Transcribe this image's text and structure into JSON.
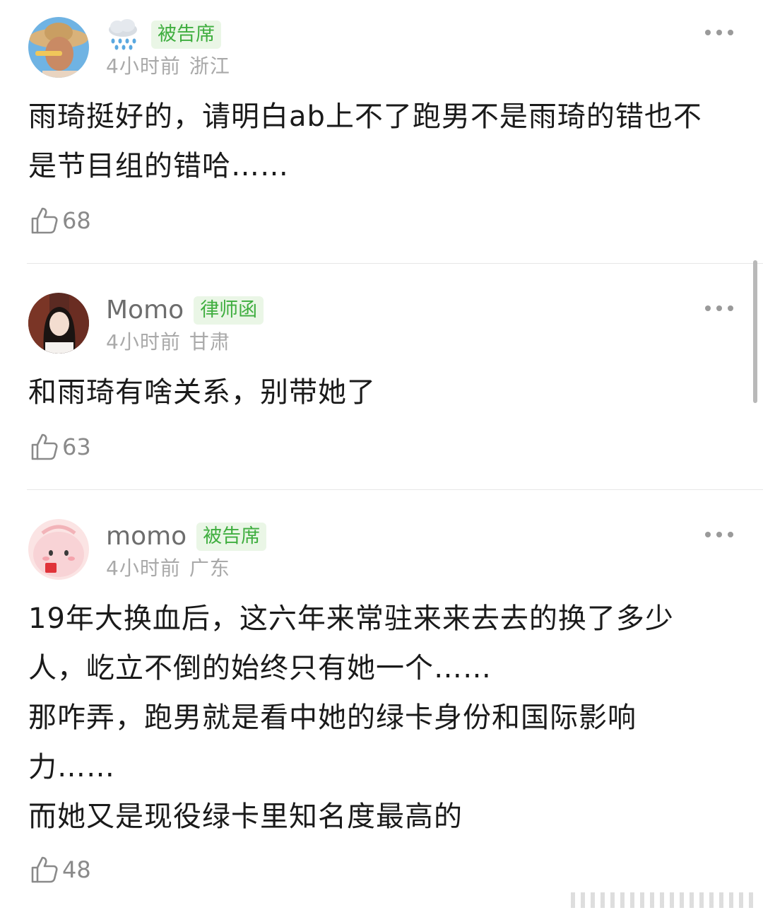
{
  "comments": [
    {
      "username": "",
      "badge": "被告席",
      "time": "4小时前",
      "location": "浙江",
      "lines": [
        "雨琦挺好的，请明白ab上不了跑男不是雨琦的错也不",
        "是节目组的错哈……"
      ],
      "likes": "68",
      "avatar_icon": "straw-hat-avatar",
      "name_icon": "rain-cloud-icon"
    },
    {
      "username": "Momo",
      "badge": "律师函",
      "time": "4小时前",
      "location": "甘肃",
      "lines": [
        "和雨琦有啥关系，别带她了"
      ],
      "likes": "63",
      "avatar_icon": "girl-portrait-avatar"
    },
    {
      "username": "momo",
      "badge": "被告席",
      "time": "4小时前",
      "location": "广东",
      "lines": [
        "19年大换血后，这六年来常驻来来去去的换了多少",
        "人，屹立不倒的始终只有她一个……",
        "那咋弄，跑男就是看中她的绿卡身份和国际影响",
        "力……",
        "而她又是现役绿卡里知名度最高的"
      ],
      "likes": "48",
      "avatar_icon": "pink-cartoon-avatar"
    }
  ],
  "colors": {
    "badge_bg": "#eaf6e6",
    "badge_text": "#3fae3f",
    "meta_text": "#a9a9a9",
    "body_text": "#1a1a1a"
  }
}
